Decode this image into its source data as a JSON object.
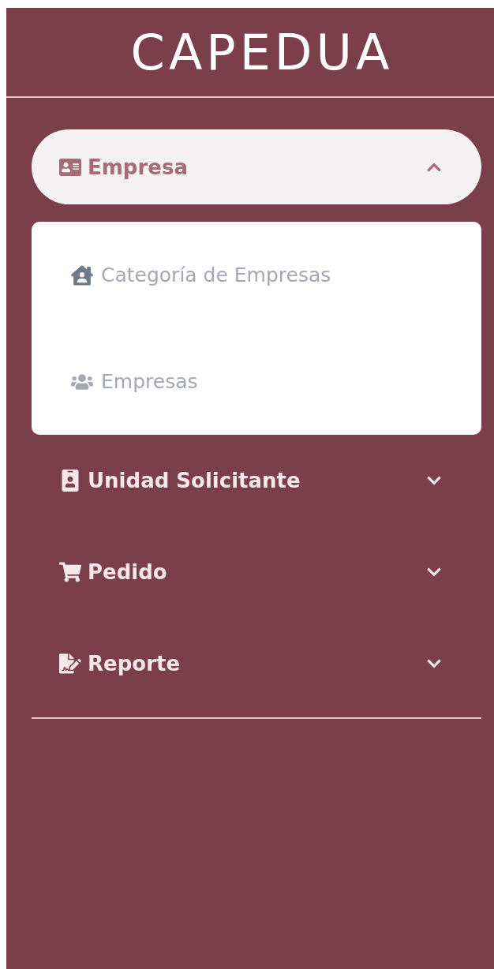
{
  "sidebar": {
    "title": "CAPEDUA",
    "items": [
      {
        "label": "Empresa",
        "expanded": true,
        "children": [
          {
            "label": "Categoría de Empresas"
          },
          {
            "label": "Empresas"
          }
        ]
      },
      {
        "label": "Unidad Solicitante",
        "expanded": false
      },
      {
        "label": "Pedido",
        "expanded": false
      },
      {
        "label": "Reporte",
        "expanded": false
      }
    ]
  }
}
